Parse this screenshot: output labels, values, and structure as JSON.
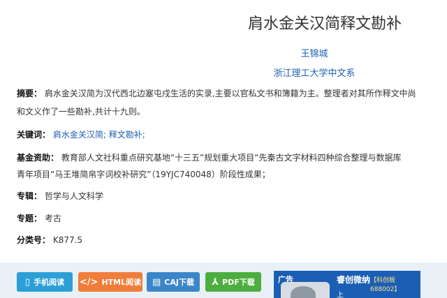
{
  "article": {
    "title": "肩水金关汉简释文勘补",
    "author": "王锦城",
    "organization": "浙江理工大学中文系"
  },
  "meta": {
    "abstract_label": "摘要：",
    "abstract_line1": "肩水金关汉简为汉代西北边塞屯戍生活的实录,主要以官私文书和簿籍为主。整理者对其所作释文中尚",
    "abstract_line2": "和文义作了一些勘补,共计十九则。",
    "keywords_label": "关键词：",
    "keywords": [
      "肩水金关汉简;",
      "释文勘补;"
    ],
    "fund_label": "基金资助：",
    "fund_line1": "教育部人文社科重点研究基地“十三五”规划重大项目“先秦古文字材料四种综合整理与数据库",
    "fund_line2": "青年项目“马王堆简帛字词校补研究”（19YJC740048）阶段性成果；",
    "series_label": "专辑：",
    "series_value": "哲学与人文科学",
    "topic_label": "专题：",
    "topic_value": "考古",
    "class_label": "分类号：",
    "class_value": "K877.5"
  },
  "buttons": {
    "mobile": "手机阅读",
    "html": "HTML阅读",
    "caj": "CAJ下载",
    "pdf": "PDF下载"
  },
  "ad": {
    "label": "广告",
    "title": "睿创微纳",
    "subtitle": "【科创板688002】",
    "line": "上"
  },
  "colors": {
    "link": "#1f5fb0",
    "btn_mobile": "#2d9fd8",
    "btn_html": "#f07d3a",
    "btn_caj": "#3b86c8",
    "btn_pdf": "#4cae3e",
    "bar_bg": "#e9f1f7"
  }
}
